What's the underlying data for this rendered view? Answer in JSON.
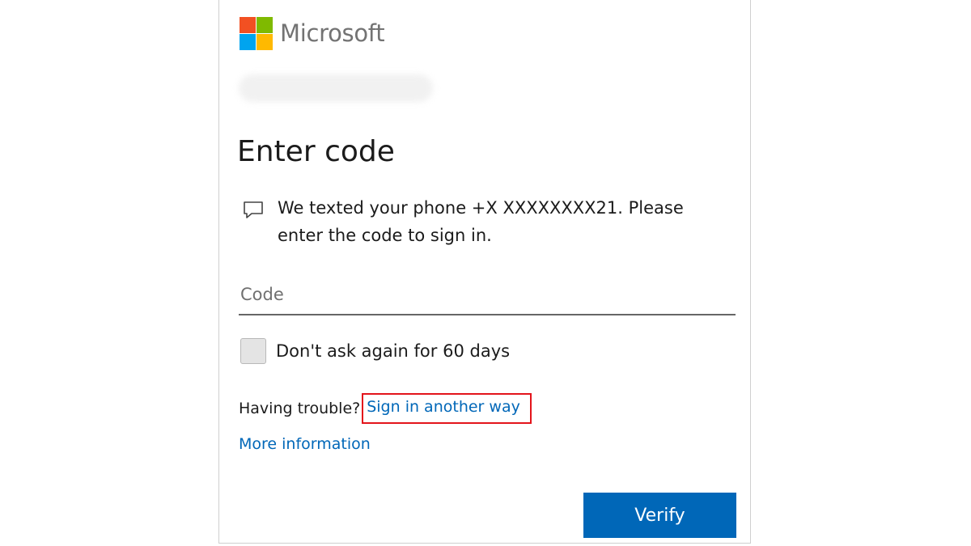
{
  "brand": {
    "name": "Microsoft",
    "colors": {
      "red": "#f25022",
      "green": "#7fba00",
      "blue": "#00a4ef",
      "yellow": "#ffb900"
    }
  },
  "page": {
    "title": "Enter code",
    "message": "We texted your phone +X XXXXXXXX21. Please enter the code to sign in.",
    "message_icon": "chat-bubble-icon"
  },
  "form": {
    "code_placeholder": "Code",
    "code_value": "",
    "remember_label": "Don't ask again for 60 days",
    "remember_checked": false
  },
  "help": {
    "trouble_text": "Having trouble?",
    "sign_in_another_way": "Sign in another way",
    "more_information": "More information"
  },
  "actions": {
    "verify_label": "Verify"
  },
  "colors": {
    "accent": "#0067b8",
    "highlight_box": "#e3141b"
  }
}
